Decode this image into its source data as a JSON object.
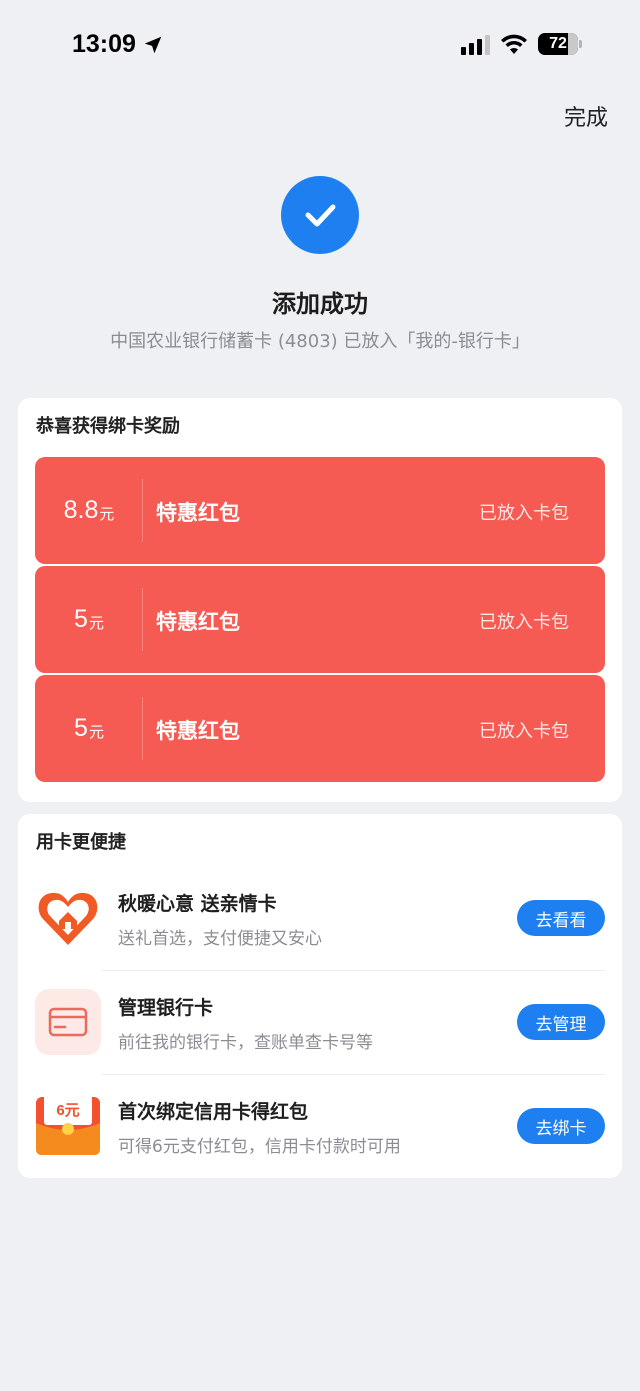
{
  "status_bar": {
    "time": "13:09",
    "battery": "72"
  },
  "header": {
    "done_label": "完成"
  },
  "success": {
    "title": "添加成功",
    "subtitle": "中国农业银行储蓄卡 (4803) 已放入「我的-银行卡」"
  },
  "rewards": {
    "title": "恭喜获得绑卡奖励",
    "items": [
      {
        "amount": "8.8",
        "unit": "元",
        "name": "特惠红包",
        "status": "已放入卡包"
      },
      {
        "amount": "5",
        "unit": "元",
        "name": "特惠红包",
        "status": "已放入卡包"
      },
      {
        "amount": "5",
        "unit": "元",
        "name": "特惠红包",
        "status": "已放入卡包"
      }
    ]
  },
  "features": {
    "title": "用卡更便捷",
    "items": [
      {
        "icon": "heart-gift-icon",
        "title": "秋暖心意 送亲情卡",
        "desc": "送礼首选，支付便捷又安心",
        "button": "去看看"
      },
      {
        "icon": "bank-card-icon",
        "title": "管理银行卡",
        "desc": "前往我的银行卡，查账单查卡号等",
        "button": "去管理"
      },
      {
        "icon": "red-envelope-icon",
        "envelope_label": "6元",
        "title": "首次绑定信用卡得红包",
        "desc": "可得6元支付红包，信用卡付款时可用",
        "button": "去绑卡"
      }
    ]
  },
  "colors": {
    "accent": "#1e7ff0",
    "reward": "#f55a53",
    "background": "#eef0f4"
  }
}
